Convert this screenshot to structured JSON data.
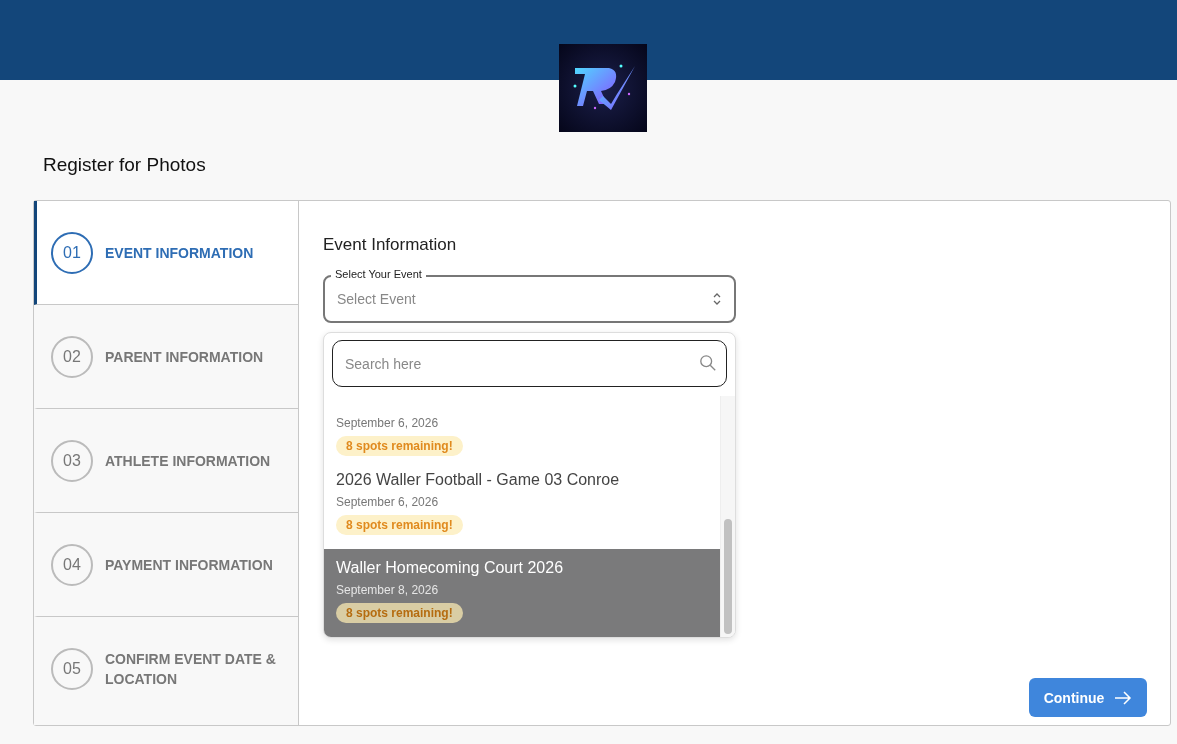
{
  "page_title": "Register for Photos",
  "steps": [
    {
      "number": "01",
      "label": "EVENT INFORMATION",
      "selected": true
    },
    {
      "number": "02",
      "label": "PARENT INFORMATION",
      "selected": false
    },
    {
      "number": "03",
      "label": "ATHLETE INFORMATION",
      "selected": false
    },
    {
      "number": "04",
      "label": "PAYMENT INFORMATION",
      "selected": false
    },
    {
      "number": "05",
      "label": "CONFIRM EVENT DATE & LOCATION",
      "selected": false
    }
  ],
  "section_title": "Event Information",
  "event_select": {
    "label": "Select Your Event",
    "placeholder": "Select Event",
    "expanded": true
  },
  "search": {
    "placeholder": "Search here"
  },
  "events": [
    {
      "date": "September 6, 2026",
      "badge": "8 spots remaining!",
      "selected": false
    },
    {
      "title": "2026 Waller Football - Game 03 Conroe",
      "date": "September 6, 2026",
      "badge": "8 spots remaining!",
      "selected": false
    },
    {
      "title": "Waller Homecoming Court 2026",
      "date": "September 8, 2026",
      "badge": "8 spots remaining!",
      "selected": true
    }
  ],
  "continue_button": "Continue"
}
